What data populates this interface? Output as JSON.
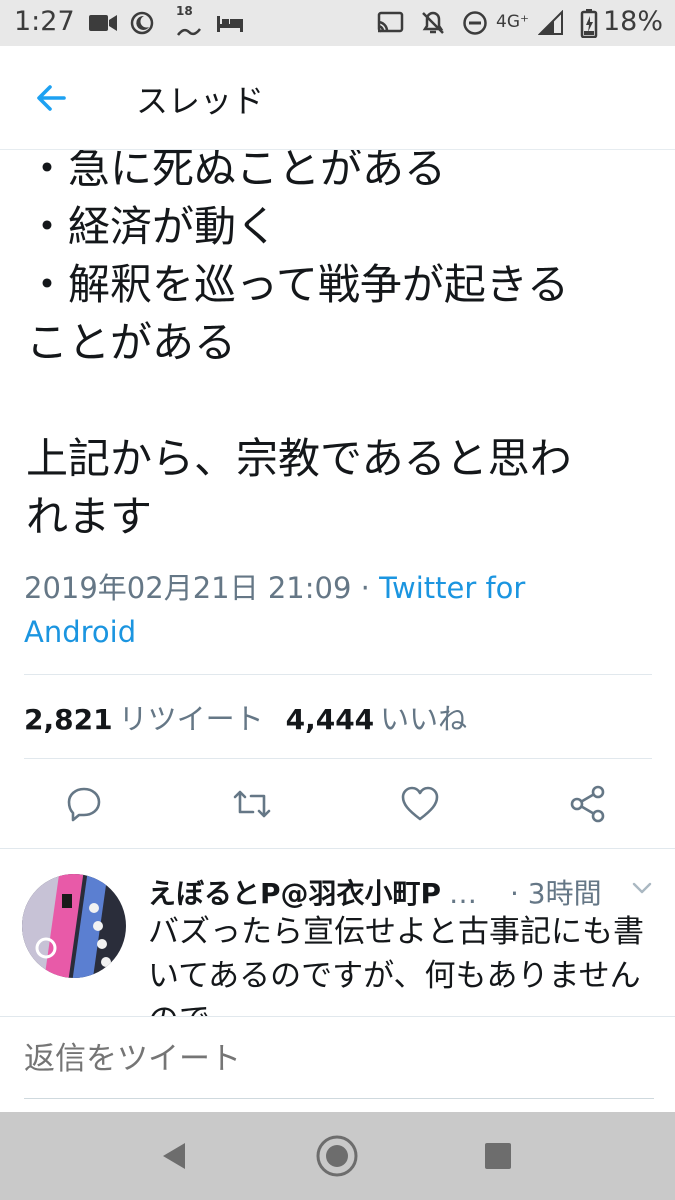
{
  "status_bar": {
    "time": "1:27",
    "network": "4G⁺",
    "battery": "18%",
    "badge": "18",
    "icons": [
      "video-icon",
      "moon-icon",
      "badge-18-icon",
      "bed-icon",
      "cast-icon",
      "bell-off-icon",
      "do-not-disturb-icon",
      "signal-icon",
      "battery-icon"
    ]
  },
  "header": {
    "title": "スレッド",
    "back_icon": "back-arrow-icon"
  },
  "tweet": {
    "text": "・急に死ぬことがある\n・経済が動く\n・解釈を巡って戦争が起きる\nことがある\n\n上記から、宗教であると思わ\nれます",
    "timestamp": "2019年02月21日 21:09",
    "separator": " · ",
    "client": "Twitter for Android",
    "retweet_count": "2,821",
    "retweet_label": "リツイート",
    "like_count": "4,444",
    "like_label": "いいね",
    "actions": [
      "reply-icon",
      "retweet-icon",
      "like-icon",
      "share-icon"
    ]
  },
  "reply": {
    "author": "えぼるとP@羽衣小町P",
    "ellipsis": "…",
    "time": "· 3時間",
    "text": "バズったら宣伝せよと古事記にも書いてあるのですが、何もありませんので"
  },
  "compose": {
    "placeholder": "返信をツイート"
  },
  "nav": {
    "buttons": [
      "back-triangle-icon",
      "home-circle-icon",
      "recents-square-icon"
    ]
  },
  "colors": {
    "accent": "#1da1f2",
    "link": "#1b95e0",
    "secondary_text": "#657786",
    "status_bar_bg": "#e8e8e8",
    "nav_bar_bg": "#c9c9c9"
  }
}
